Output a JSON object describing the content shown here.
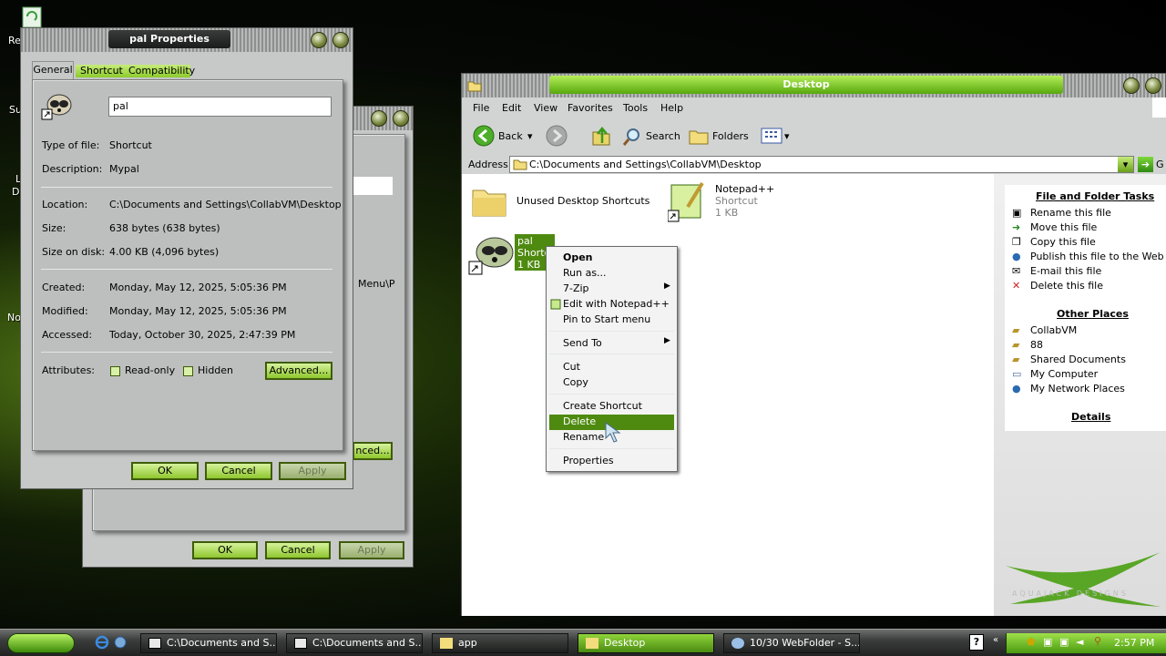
{
  "desktop": {
    "icon_labels": [
      "Re",
      "Su",
      "L",
      "De",
      "No"
    ],
    "watermark": "AQUAJACK DESIGNS"
  },
  "back_dialog": {
    "partial_text": "Menu\\P",
    "advanced_partial": "nced...",
    "ok": "OK",
    "cancel": "Cancel",
    "apply": "Apply"
  },
  "properties": {
    "title": "pal Properties",
    "tabs": [
      "General",
      "Shortcut",
      "Compatibility"
    ],
    "name_value": "pal",
    "type_label": "Type of file:",
    "type_value": "Shortcut",
    "desc_label": "Description:",
    "desc_value": "Mypal",
    "location_label": "Location:",
    "location_value": "C:\\Documents and Settings\\CollabVM\\Desktop",
    "size_label": "Size:",
    "size_value": "638 bytes (638 bytes)",
    "disk_label": "Size on disk:",
    "disk_value": "4.00 KB (4,096 bytes)",
    "created_label": "Created:",
    "created_value": "Monday, May 12, 2025, 5:05:36 PM",
    "modified_label": "Modified:",
    "modified_value": "Monday, May 12, 2025, 5:05:36 PM",
    "accessed_label": "Accessed:",
    "accessed_value": "Today, October 30, 2025, 2:47:39 PM",
    "attributes_label": "Attributes:",
    "readonly_label": "Read-only",
    "hidden_label": "Hidden",
    "advanced_label": "Advanced...",
    "ok": "OK",
    "cancel": "Cancel",
    "apply": "Apply"
  },
  "explorer": {
    "title": "Desktop",
    "menu": [
      "File",
      "Edit",
      "View",
      "Favorites",
      "Tools",
      "Help"
    ],
    "toolbar": {
      "back": "Back",
      "search": "Search",
      "folders": "Folders"
    },
    "address_label": "Address",
    "address_value": "C:\\Documents and Settings\\CollabVM\\Desktop",
    "go_label": "G",
    "files": [
      {
        "name": "Unused Desktop Shortcuts"
      },
      {
        "name": "Notepad++",
        "type": "Shortcut",
        "size": "1 KB"
      },
      {
        "name": "pal",
        "type": "Shortcut",
        "size": "1 KB"
      }
    ],
    "tasks_title": "File and Folder Tasks",
    "tasks": [
      "Rename this file",
      "Move this file",
      "Copy this file",
      "Publish this file to the Web",
      "E-mail this file",
      "Delete this file"
    ],
    "places_title": "Other Places",
    "places": [
      "CollabVM",
      "88",
      "Shared Documents",
      "My Computer",
      "My Network Places"
    ],
    "details_title": "Details"
  },
  "context_menu": {
    "items": [
      "Open",
      "Run as...",
      "7-Zip",
      "Edit with Notepad++",
      "Pin to Start menu",
      "Send To",
      "Cut",
      "Copy",
      "Create Shortcut",
      "Delete",
      "Rename",
      "Properties"
    ],
    "highlighted": "Delete"
  },
  "taskbar": {
    "buttons": [
      "C:\\Documents and S...",
      "C:\\Documents and S...",
      "app",
      "Desktop",
      "10/30 WebFolder - S..."
    ],
    "active": "Desktop",
    "clock": "2:57 PM"
  },
  "colors": {
    "accent": "#7cc82a",
    "highlight": "#4f8a10"
  }
}
